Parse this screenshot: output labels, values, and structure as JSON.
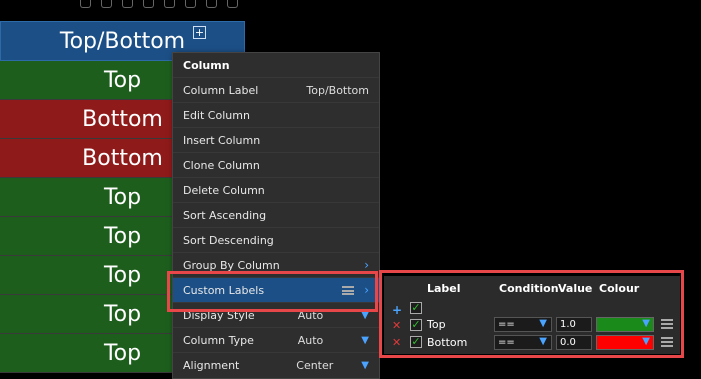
{
  "grid": {
    "header": "Top/Bottom",
    "rows": [
      {
        "text": "Top",
        "kind": "top"
      },
      {
        "text": "Bottom",
        "kind": "bottom"
      },
      {
        "text": "Bottom",
        "kind": "bottom"
      },
      {
        "text": "Top",
        "kind": "top"
      },
      {
        "text": "Top",
        "kind": "top"
      },
      {
        "text": "Top",
        "kind": "top"
      },
      {
        "text": "Top",
        "kind": "top"
      },
      {
        "text": "Top",
        "kind": "top"
      }
    ]
  },
  "menu": {
    "title": "Column",
    "column_label": "Column Label",
    "column_label_value": "Top/Bottom",
    "edit": "Edit Column",
    "insert": "Insert Column",
    "clone": "Clone Column",
    "delete": "Delete Column",
    "sort_asc": "Sort Ascending",
    "sort_desc": "Sort Descending",
    "group_by": "Group By Column",
    "custom_labels": "Custom Labels",
    "display_style": "Display Style",
    "display_style_value": "Auto",
    "column_type": "Column Type",
    "column_type_value": "Auto",
    "alignment": "Alignment",
    "alignment_value": "Center"
  },
  "panel": {
    "headers": {
      "label": "Label",
      "condition": "Condition",
      "value": "Value",
      "colour": "Colour"
    },
    "rows": [
      {
        "label": "Top",
        "condition": "==",
        "value": "1.0",
        "colour": "#1a8a1a"
      },
      {
        "label": "Bottom",
        "condition": "==",
        "value": "0.0",
        "colour": "#ff0000"
      }
    ]
  },
  "colors": {
    "top_row": "#1d5e1d",
    "bottom_row": "#8f1a1a",
    "header": "#1c4f86",
    "highlight": "#e8474a"
  }
}
